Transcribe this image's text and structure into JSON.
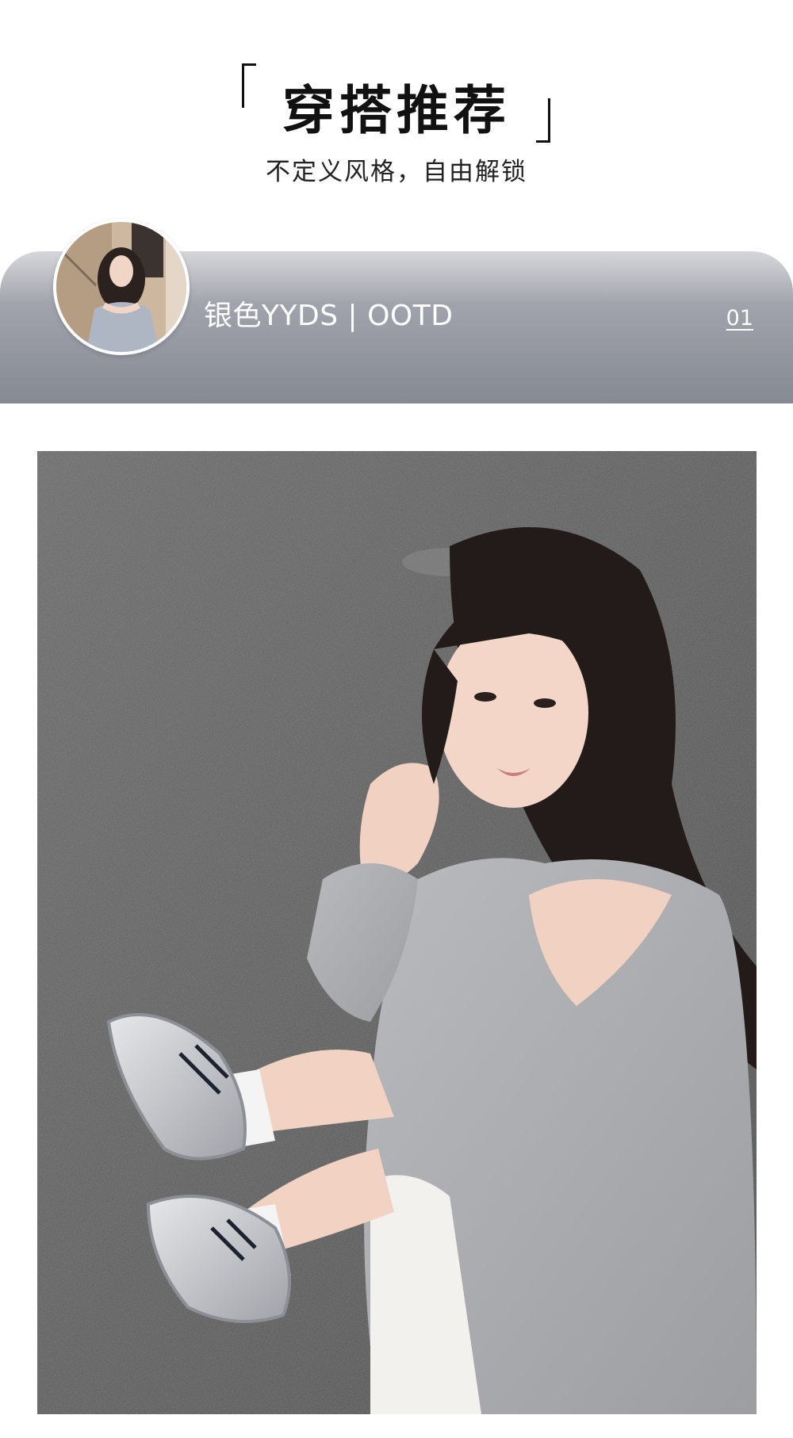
{
  "header": {
    "title": "穿搭推荐",
    "subtitle": "不定义风格，自由解锁"
  },
  "banner": {
    "label": "银色YYDS | OOTD",
    "index": "01"
  },
  "avatar": {
    "alt": "model avatar"
  },
  "photo": {
    "alt": "model sitting on asphalt wearing grey off-shoulder sweatshirt and silver sneakers"
  },
  "colors": {
    "banner_top": "#d6d7db",
    "banner_bottom": "#868a93",
    "text_dark": "#111111",
    "white": "#ffffff"
  }
}
